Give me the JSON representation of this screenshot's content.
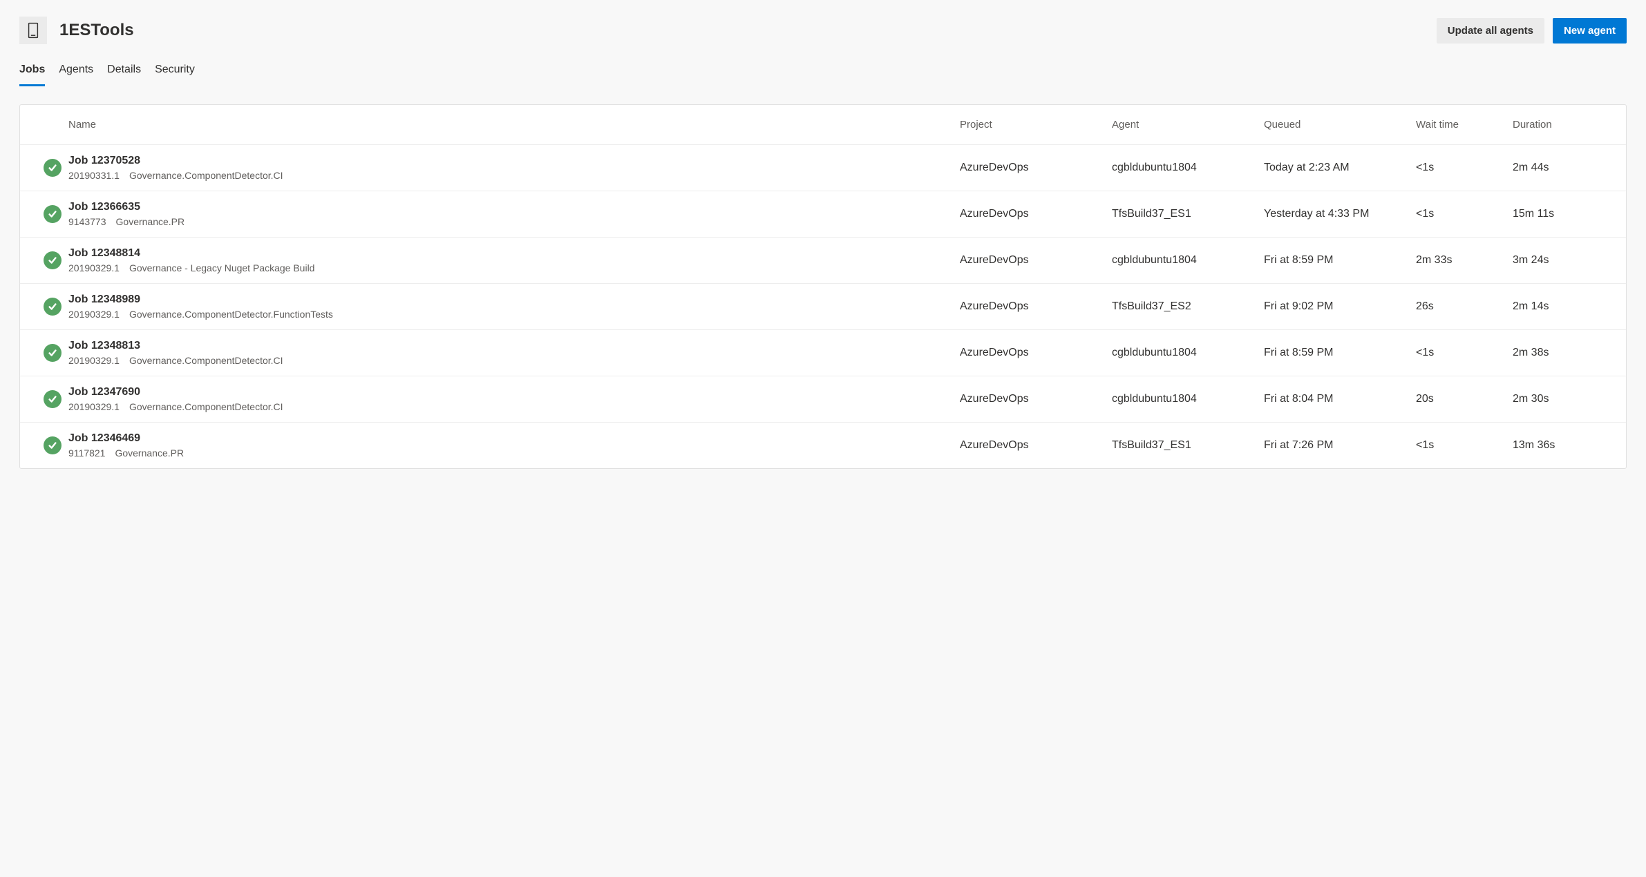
{
  "header": {
    "title": "1ESTools",
    "update_all_label": "Update all agents",
    "new_agent_label": "New agent"
  },
  "tabs": [
    {
      "label": "Jobs",
      "active": true
    },
    {
      "label": "Agents",
      "active": false
    },
    {
      "label": "Details",
      "active": false
    },
    {
      "label": "Security",
      "active": false
    }
  ],
  "columns": {
    "name": "Name",
    "project": "Project",
    "agent": "Agent",
    "queued": "Queued",
    "wait_time": "Wait time",
    "duration": "Duration"
  },
  "jobs": [
    {
      "status": "success",
      "title": "Job 12370528",
      "build": "20190331.1",
      "pipeline": "Governance.ComponentDetector.CI",
      "project": "AzureDevOps",
      "agent": "cgbldubuntu1804",
      "queued": "Today at 2:23 AM",
      "wait_time": "<1s",
      "duration": "2m 44s"
    },
    {
      "status": "success",
      "title": "Job 12366635",
      "build": "9143773",
      "pipeline": "Governance.PR",
      "project": "AzureDevOps",
      "agent": "TfsBuild37_ES1",
      "queued": "Yesterday at 4:33 PM",
      "wait_time": "<1s",
      "duration": "15m 11s"
    },
    {
      "status": "success",
      "title": "Job 12348814",
      "build": "20190329.1",
      "pipeline": "Governance - Legacy Nuget Package Build",
      "project": "AzureDevOps",
      "agent": "cgbldubuntu1804",
      "queued": "Fri at 8:59 PM",
      "wait_time": "2m 33s",
      "duration": "3m 24s"
    },
    {
      "status": "success",
      "title": "Job 12348989",
      "build": "20190329.1",
      "pipeline": "Governance.ComponentDetector.FunctionTests",
      "project": "AzureDevOps",
      "agent": "TfsBuild37_ES2",
      "queued": "Fri at 9:02 PM",
      "wait_time": "26s",
      "duration": "2m 14s"
    },
    {
      "status": "success",
      "title": "Job 12348813",
      "build": "20190329.1",
      "pipeline": "Governance.ComponentDetector.CI",
      "project": "AzureDevOps",
      "agent": "cgbldubuntu1804",
      "queued": "Fri at 8:59 PM",
      "wait_time": "<1s",
      "duration": "2m 38s"
    },
    {
      "status": "success",
      "title": "Job 12347690",
      "build": "20190329.1",
      "pipeline": "Governance.ComponentDetector.CI",
      "project": "AzureDevOps",
      "agent": "cgbldubuntu1804",
      "queued": "Fri at 8:04 PM",
      "wait_time": "20s",
      "duration": "2m 30s"
    },
    {
      "status": "success",
      "title": "Job 12346469",
      "build": "9117821",
      "pipeline": "Governance.PR",
      "project": "AzureDevOps",
      "agent": "TfsBuild37_ES1",
      "queued": "Fri at 7:26 PM",
      "wait_time": "<1s",
      "duration": "13m 36s"
    }
  ]
}
